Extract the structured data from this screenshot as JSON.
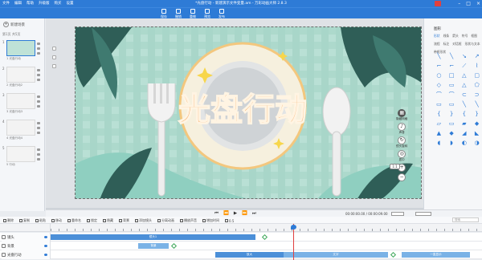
{
  "app": {
    "title": "*光盘行动 - 新建演示文件变量.am - 万彩动画大师 2.8.3",
    "menu": [
      "文件",
      "编辑",
      "帮助",
      "升级版",
      "购买",
      "设置"
    ]
  },
  "toolbar": {
    "items": [
      "保存",
      "撤销",
      "重做",
      "预览",
      "发布"
    ]
  },
  "left_panel": {
    "new_scene": "新建场景",
    "scene_header": "第1页 共5页",
    "scenes": [
      {
        "num": "1",
        "caption": "1   光盘行动",
        "active": true
      },
      {
        "num": "2",
        "caption": "2   光盘行动2",
        "active": false
      },
      {
        "num": "3",
        "caption": "3   光盘行动3",
        "active": false
      },
      {
        "num": "4",
        "caption": "4   光盘行动4",
        "active": false
      },
      {
        "num": "5",
        "caption": "5   行动",
        "active": false
      }
    ]
  },
  "canvas": {
    "headline": "光盘行动",
    "right_tools": [
      {
        "icon": "grid-icon",
        "label": "隐藏网格"
      },
      {
        "icon": "bell-icon",
        "label": "声音"
      },
      {
        "icon": "rotate-icon",
        "label": "镜头旋转"
      },
      {
        "icon": "center-icon",
        "label": "居中"
      },
      {
        "icon": "fit-icon",
        "label": "1:1"
      },
      {
        "icon": "plus-icon",
        "label": ""
      },
      {
        "icon": "minus-icon",
        "label": ""
      }
    ],
    "zoom": "1:1"
  },
  "right_panel": {
    "title": "图形",
    "tabs": [
      "形状",
      "线条",
      "箭头",
      "符号",
      "框图",
      "流程",
      "标注",
      "对话框",
      "形状与文本",
      "带框形状"
    ],
    "active_tab": "形状",
    "shapes": [
      "╲",
      "╲",
      "↘",
      "↗",
      "⌐",
      "⌐",
      "⟋",
      "⌇",
      "○",
      "□",
      "△",
      "▢",
      "◇",
      "▭",
      "△",
      "⬠",
      "⌒",
      "⌒",
      "⊂",
      "⊃",
      "▭",
      "▭",
      "╲",
      "╲",
      "{",
      "}",
      "{",
      "}",
      "▱",
      "▭",
      "▰",
      "◆",
      "▲",
      "◆",
      "◢",
      "◣",
      "◖",
      "◗",
      "◐",
      "◑"
    ]
  },
  "playback": {
    "controls": [
      "⏮",
      "⏪",
      "▶",
      "⏩",
      "⏭"
    ],
    "time": "00:00:00.00 / 00:00:09.00",
    "progress": 0.56
  },
  "timeline_toolbar": {
    "items": [
      "删除",
      "复制",
      "粘贴",
      "移动",
      "重命名",
      "锁定",
      "隐藏",
      "背景",
      "添加镜头",
      "分离动画",
      "播放声音",
      "增加时间",
      "0.5"
    ],
    "search_placeholder": "搜索"
  },
  "tracks": [
    {
      "name": "镜头",
      "bars": [
        {
          "label": "镜头1",
          "type": "dark"
        }
      ]
    },
    {
      "name": "背景",
      "bars": [
        {
          "label": "背景",
          "type": "light"
        }
      ]
    },
    {
      "name": "光盘行动",
      "bars": [
        {
          "label": "放大",
          "type": "dark"
        },
        {
          "label": "文字",
          "type": "light"
        },
        {
          "label": "一直显示",
          "type": "light"
        }
      ]
    }
  ],
  "colors": {
    "accent": "#2e7bd6",
    "stage_bg": "#b9e0d5",
    "headline": "#f39a45",
    "plate": "#f6f0de"
  }
}
